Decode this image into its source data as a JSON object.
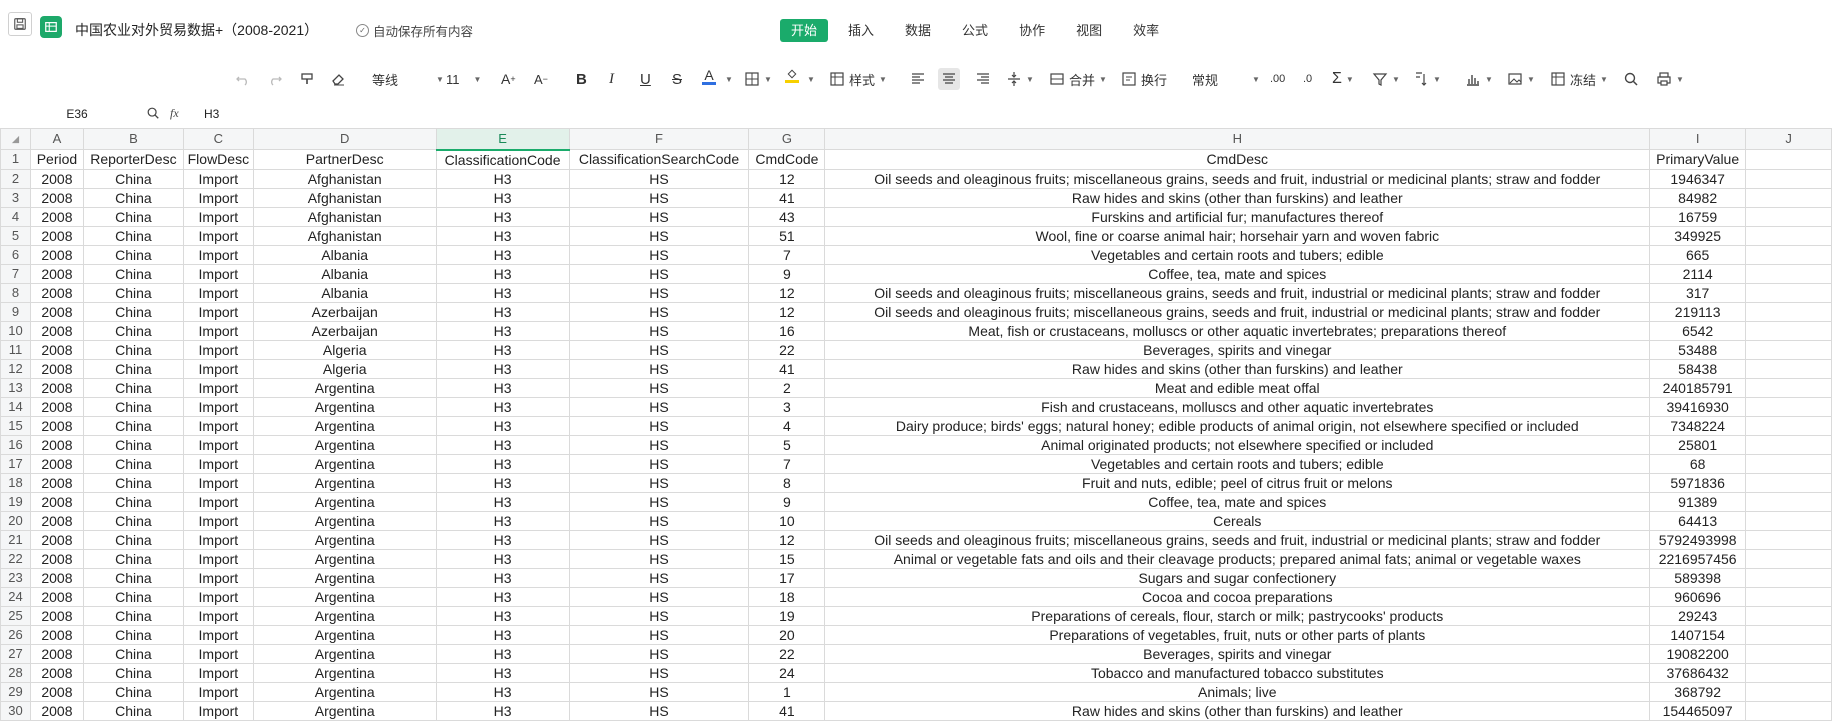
{
  "app": {
    "doc_title": "中国农业对外贸易数据+（2008-2021）",
    "autosave_text": "自动保存所有内容",
    "menu": [
      "开始",
      "插入",
      "数据",
      "公式",
      "协作",
      "视图",
      "效率"
    ],
    "active_menu": "开始"
  },
  "toolbar": {
    "font_name": "等线",
    "font_size": "11",
    "style_label": "样式",
    "merge_label": "合并",
    "wrap_label": "换行",
    "number_format": "常规",
    "freeze_label": "冻结",
    "font_color": "#2f6fe0",
    "fill_color": "#f7d000",
    "accent": "#1aab6b"
  },
  "formula_bar": {
    "cell_ref": "E36",
    "fx_label": "fx",
    "value": "H3"
  },
  "sheet": {
    "col_letters": [
      "A",
      "B",
      "C",
      "D",
      "E",
      "F",
      "G",
      "H",
      "I",
      "J"
    ],
    "selected_col": "E",
    "headers": [
      "Period",
      "ReporterDesc",
      "FlowDesc",
      "PartnerDesc",
      "ClassificationCode",
      "ClassificationSearchCode",
      "CmdCode",
      "CmdDesc",
      "PrimaryValue",
      ""
    ],
    "rows": [
      [
        "2008",
        "China",
        "Import",
        "Afghanistan",
        "H3",
        "HS",
        "12",
        "Oil seeds and oleaginous fruits; miscellaneous grains, seeds and fruit, industrial or medicinal plants; straw and fodder",
        "1946347"
      ],
      [
        "2008",
        "China",
        "Import",
        "Afghanistan",
        "H3",
        "HS",
        "41",
        "Raw hides and skins (other than furskins) and leather",
        "84982"
      ],
      [
        "2008",
        "China",
        "Import",
        "Afghanistan",
        "H3",
        "HS",
        "43",
        "Furskins and artificial fur; manufactures thereof",
        "16759"
      ],
      [
        "2008",
        "China",
        "Import",
        "Afghanistan",
        "H3",
        "HS",
        "51",
        "Wool, fine or coarse animal hair; horsehair yarn and woven fabric",
        "349925"
      ],
      [
        "2008",
        "China",
        "Import",
        "Albania",
        "H3",
        "HS",
        "7",
        "Vegetables and certain roots and tubers; edible",
        "665"
      ],
      [
        "2008",
        "China",
        "Import",
        "Albania",
        "H3",
        "HS",
        "9",
        "Coffee, tea, mate and spices",
        "2114"
      ],
      [
        "2008",
        "China",
        "Import",
        "Albania",
        "H3",
        "HS",
        "12",
        "Oil seeds and oleaginous fruits; miscellaneous grains, seeds and fruit, industrial or medicinal plants; straw and fodder",
        "317"
      ],
      [
        "2008",
        "China",
        "Import",
        "Azerbaijan",
        "H3",
        "HS",
        "12",
        "Oil seeds and oleaginous fruits; miscellaneous grains, seeds and fruit, industrial or medicinal plants; straw and fodder",
        "219113"
      ],
      [
        "2008",
        "China",
        "Import",
        "Azerbaijan",
        "H3",
        "HS",
        "16",
        "Meat, fish or crustaceans, molluscs or other aquatic invertebrates; preparations thereof",
        "6542"
      ],
      [
        "2008",
        "China",
        "Import",
        "Algeria",
        "H3",
        "HS",
        "22",
        "Beverages, spirits and vinegar",
        "53488"
      ],
      [
        "2008",
        "China",
        "Import",
        "Algeria",
        "H3",
        "HS",
        "41",
        "Raw hides and skins (other than furskins) and leather",
        "58438"
      ],
      [
        "2008",
        "China",
        "Import",
        "Argentina",
        "H3",
        "HS",
        "2",
        "Meat and edible meat offal",
        "240185791"
      ],
      [
        "2008",
        "China",
        "Import",
        "Argentina",
        "H3",
        "HS",
        "3",
        "Fish and crustaceans, molluscs and other aquatic invertebrates",
        "39416930"
      ],
      [
        "2008",
        "China",
        "Import",
        "Argentina",
        "H3",
        "HS",
        "4",
        "Dairy produce; birds' eggs; natural honey; edible products of animal origin, not elsewhere specified or included",
        "7348224"
      ],
      [
        "2008",
        "China",
        "Import",
        "Argentina",
        "H3",
        "HS",
        "5",
        "Animal originated products; not elsewhere specified or included",
        "25801"
      ],
      [
        "2008",
        "China",
        "Import",
        "Argentina",
        "H3",
        "HS",
        "7",
        "Vegetables and certain roots and tubers; edible",
        "68"
      ],
      [
        "2008",
        "China",
        "Import",
        "Argentina",
        "H3",
        "HS",
        "8",
        "Fruit and nuts, edible; peel of citrus fruit or melons",
        "5971836"
      ],
      [
        "2008",
        "China",
        "Import",
        "Argentina",
        "H3",
        "HS",
        "9",
        "Coffee, tea, mate and spices",
        "91389"
      ],
      [
        "2008",
        "China",
        "Import",
        "Argentina",
        "H3",
        "HS",
        "10",
        "Cereals",
        "64413"
      ],
      [
        "2008",
        "China",
        "Import",
        "Argentina",
        "H3",
        "HS",
        "12",
        "Oil seeds and oleaginous fruits; miscellaneous grains, seeds and fruit, industrial or medicinal plants; straw and fodder",
        "5792493998"
      ],
      [
        "2008",
        "China",
        "Import",
        "Argentina",
        "H3",
        "HS",
        "15",
        "Animal or vegetable fats and oils and their cleavage products; prepared animal fats; animal or vegetable waxes",
        "2216957456"
      ],
      [
        "2008",
        "China",
        "Import",
        "Argentina",
        "H3",
        "HS",
        "17",
        "Sugars and sugar confectionery",
        "589398"
      ],
      [
        "2008",
        "China",
        "Import",
        "Argentina",
        "H3",
        "HS",
        "18",
        "Cocoa and cocoa preparations",
        "960696"
      ],
      [
        "2008",
        "China",
        "Import",
        "Argentina",
        "H3",
        "HS",
        "19",
        "Preparations of cereals, flour, starch or milk; pastrycooks' products",
        "29243"
      ],
      [
        "2008",
        "China",
        "Import",
        "Argentina",
        "H3",
        "HS",
        "20",
        "Preparations of vegetables, fruit, nuts or other parts of plants",
        "1407154"
      ],
      [
        "2008",
        "China",
        "Import",
        "Argentina",
        "H3",
        "HS",
        "22",
        "Beverages, spirits and vinegar",
        "19082200"
      ],
      [
        "2008",
        "China",
        "Import",
        "Argentina",
        "H3",
        "HS",
        "24",
        "Tobacco and manufactured tobacco substitutes",
        "37686432"
      ],
      [
        "2008",
        "China",
        "Import",
        "Argentina",
        "H3",
        "HS",
        "1",
        "Animals; live",
        "368792"
      ],
      [
        "2008",
        "China",
        "Import",
        "Argentina",
        "H3",
        "HS",
        "41",
        "Raw hides and skins (other than furskins) and leather",
        "154465097"
      ]
    ]
  }
}
